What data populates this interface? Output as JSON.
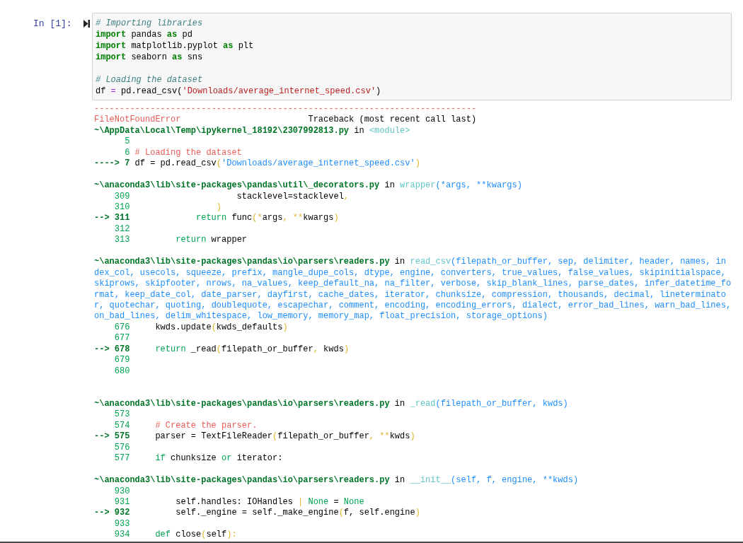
{
  "cell": {
    "prompt": "In [1]:",
    "input_lines": [
      {
        "kind": "code",
        "segments": [
          {
            "text": "# Importing libraries",
            "kind": "comment"
          }
        ]
      },
      {
        "kind": "code",
        "segments": [
          {
            "text": "import",
            "kind": "keyword"
          },
          {
            "text": " pandas ",
            "kind": "plain"
          },
          {
            "text": "as",
            "kind": "keyword"
          },
          {
            "text": " pd",
            "kind": "plain"
          }
        ]
      },
      {
        "kind": "code",
        "segments": [
          {
            "text": "import",
            "kind": "keyword"
          },
          {
            "text": " matplotlib.pyplot ",
            "kind": "plain"
          },
          {
            "text": "as",
            "kind": "keyword"
          },
          {
            "text": " plt",
            "kind": "plain"
          }
        ]
      },
      {
        "kind": "code",
        "segments": [
          {
            "text": "import",
            "kind": "keyword"
          },
          {
            "text": " seaborn ",
            "kind": "plain"
          },
          {
            "text": "as",
            "kind": "keyword"
          },
          {
            "text": " sns",
            "kind": "plain"
          }
        ]
      },
      {
        "kind": "blank"
      },
      {
        "kind": "code",
        "segments": [
          {
            "text": "# Loading the dataset",
            "kind": "comment"
          }
        ]
      },
      {
        "kind": "code",
        "segments": [
          {
            "text": "df ",
            "kind": "plain"
          },
          {
            "text": "=",
            "kind": "operator"
          },
          {
            "text": " pd.read_csv(",
            "kind": "plain"
          },
          {
            "text": "'Downloads/average_internet_speed.csv'",
            "kind": "string"
          },
          {
            "text": ")",
            "kind": "plain"
          }
        ]
      }
    ],
    "output": {
      "rule": "---------------------------------------------------------------------------",
      "error_name": "FileNotFoundError",
      "traceback_label": "Traceback (most recent call last)",
      "frames": [
        {
          "header": [
            {
              "text": "~\\AppData\\Local\\Temp\\ipykernel_18192\\2307992813.py",
              "kind": "path"
            },
            {
              "text": " in ",
              "kind": "plain"
            },
            {
              "text": "<module>",
              "kind": "func"
            }
          ],
          "lines": [
            {
              "kind": "source",
              "number": "5"
            },
            {
              "kind": "source",
              "number": "6",
              "code": [
                {
                  "text": "# Loading the dataset",
                  "kind": "comment"
                }
              ]
            },
            {
              "kind": "source",
              "arrow": "---->",
              "number": "7",
              "code": [
                {
                  "text": "df = pd.read_csv",
                  "kind": "plain"
                },
                {
                  "text": "(",
                  "kind": "punct"
                },
                {
                  "text": "'Downloads/average_internet_speed.csv'",
                  "kind": "string"
                },
                {
                  "text": ")",
                  "kind": "punct"
                }
              ]
            }
          ]
        },
        {
          "header": [
            {
              "text": "~\\anaconda3\\lib\\site-packages\\pandas\\util\\_decorators.py",
              "kind": "path"
            },
            {
              "text": " in ",
              "kind": "plain"
            },
            {
              "text": "wrapper",
              "kind": "func"
            },
            {
              "text": "(*args, **kwargs)",
              "kind": "args"
            }
          ],
          "lines": [
            {
              "kind": "source",
              "number": "309",
              "code": [
                {
                  "text": "                    stacklevel=stacklevel",
                  "kind": "plain"
                },
                {
                  "text": ",",
                  "kind": "punct"
                }
              ]
            },
            {
              "kind": "source",
              "number": "310",
              "code": [
                {
                  "text": "                )",
                  "kind": "punct"
                }
              ]
            },
            {
              "kind": "source",
              "arrow": "-->",
              "number": "311",
              "code": [
                {
                  "text": "            return",
                  "kind": "keyword"
                },
                {
                  "text": " func",
                  "kind": "plain"
                },
                {
                  "text": "(*",
                  "kind": "punct"
                },
                {
                  "text": "args",
                  "kind": "plain"
                },
                {
                  "text": ", **",
                  "kind": "punct"
                },
                {
                  "text": "kwargs",
                  "kind": "plain"
                },
                {
                  "text": ")",
                  "kind": "punct"
                }
              ]
            },
            {
              "kind": "source",
              "number": "312"
            },
            {
              "kind": "source",
              "number": "313",
              "code": [
                {
                  "text": "        return",
                  "kind": "keyword"
                },
                {
                  "text": " wrapper",
                  "kind": "plain"
                }
              ]
            }
          ]
        },
        {
          "header": [
            {
              "text": "~\\anaconda3\\lib\\site-packages\\pandas\\io\\parsers\\readers.py",
              "kind": "path"
            },
            {
              "text": " in ",
              "kind": "plain"
            },
            {
              "text": "read_csv",
              "kind": "func"
            },
            {
              "text": "(filepath_or_buffer, sep, delimiter, header, names, index_col, usecols, squeeze, prefix, mangle_dupe_cols, dtype, engine, converters, true_values, false_values, skipinitialspace, skiprows, skipfooter, nrows, na_values, keep_default_na, na_filter, verbose, skip_blank_lines, parse_dates, infer_datetime_format, keep_date_col, date_parser, dayfirst, cache_dates, iterator, chunksize, compression, thousands, decimal, lineterminator, quotechar, quoting, doublequote, escapechar, comment, encoding, encoding_errors, dialect, error_bad_lines, warn_bad_lines, on_bad_lines, delim_whitespace, low_memory, memory_map, float_precision, storage_options)",
              "kind": "args"
            }
          ],
          "lines": [
            {
              "kind": "source",
              "number": "676",
              "code": [
                {
                  "text": "    kwds.update",
                  "kind": "plain"
                },
                {
                  "text": "(",
                  "kind": "punct"
                },
                {
                  "text": "kwds_defaults",
                  "kind": "plain"
                },
                {
                  "text": ")",
                  "kind": "punct"
                }
              ]
            },
            {
              "kind": "source",
              "number": "677"
            },
            {
              "kind": "source",
              "arrow": "-->",
              "number": "678",
              "code": [
                {
                  "text": "    return",
                  "kind": "keyword"
                },
                {
                  "text": " _read",
                  "kind": "plain"
                },
                {
                  "text": "(",
                  "kind": "punct"
                },
                {
                  "text": "filepath_or_buffer",
                  "kind": "plain"
                },
                {
                  "text": ",",
                  "kind": "punct"
                },
                {
                  "text": " kwds",
                  "kind": "plain"
                },
                {
                  "text": ")",
                  "kind": "punct"
                }
              ]
            },
            {
              "kind": "source",
              "number": "679"
            },
            {
              "kind": "source",
              "number": "680"
            },
            {
              "kind": "blank"
            }
          ]
        },
        {
          "header": [
            {
              "text": "~\\anaconda3\\lib\\site-packages\\pandas\\io\\parsers\\readers.py",
              "kind": "path"
            },
            {
              "text": " in ",
              "kind": "plain"
            },
            {
              "text": "_read",
              "kind": "func"
            },
            {
              "text": "(filepath_or_buffer, kwds)",
              "kind": "args"
            }
          ],
          "lines": [
            {
              "kind": "source",
              "number": "573"
            },
            {
              "kind": "source",
              "number": "574",
              "code": [
                {
                  "text": "    # Create the parser.",
                  "kind": "comment"
                }
              ]
            },
            {
              "kind": "source",
              "arrow": "-->",
              "number": "575",
              "code": [
                {
                  "text": "    parser = TextFileReader",
                  "kind": "plain"
                },
                {
                  "text": "(",
                  "kind": "punct"
                },
                {
                  "text": "filepath_or_buffer",
                  "kind": "plain"
                },
                {
                  "text": ", **",
                  "kind": "punct"
                },
                {
                  "text": "kwds",
                  "kind": "plain"
                },
                {
                  "text": ")",
                  "kind": "punct"
                }
              ]
            },
            {
              "kind": "source",
              "number": "576"
            },
            {
              "kind": "source",
              "number": "577",
              "code": [
                {
                  "text": "    if",
                  "kind": "keyword"
                },
                {
                  "text": " chunksize ",
                  "kind": "plain"
                },
                {
                  "text": "or",
                  "kind": "keyword"
                },
                {
                  "text": " iterator:",
                  "kind": "plain"
                }
              ]
            }
          ]
        },
        {
          "header": [
            {
              "text": "~\\anaconda3\\lib\\site-packages\\pandas\\io\\parsers\\readers.py",
              "kind": "path"
            },
            {
              "text": " in ",
              "kind": "plain"
            },
            {
              "text": "__init__",
              "kind": "func"
            },
            {
              "text": "(self, f, engine, **kwds)",
              "kind": "args"
            }
          ],
          "lines": [
            {
              "kind": "source",
              "number": "930"
            },
            {
              "kind": "source",
              "number": "931",
              "code": [
                {
                  "text": "        self.handles: IOHandles ",
                  "kind": "plain"
                },
                {
                  "text": "|",
                  "kind": "punct"
                },
                {
                  "text": " None",
                  "kind": "keyword"
                },
                {
                  "text": " = ",
                  "kind": "plain"
                },
                {
                  "text": "None",
                  "kind": "keyword"
                }
              ]
            },
            {
              "kind": "source",
              "arrow": "-->",
              "number": "932",
              "code": [
                {
                  "text": "        self._engine = self._make_engine",
                  "kind": "plain"
                },
                {
                  "text": "(",
                  "kind": "punct"
                },
                {
                  "text": "f, self.engine",
                  "kind": "plain"
                },
                {
                  "text": ")",
                  "kind": "punct"
                }
              ]
            },
            {
              "kind": "source",
              "number": "933"
            },
            {
              "kind": "source",
              "number": "934",
              "code": [
                {
                  "text": "    def",
                  "kind": "keyword"
                },
                {
                  "text": " close",
                  "kind": "plain"
                },
                {
                  "text": "(",
                  "kind": "punct"
                },
                {
                  "text": "self",
                  "kind": "plain"
                },
                {
                  "text": "):",
                  "kind": "punct"
                }
              ]
            }
          ]
        }
      ]
    }
  }
}
